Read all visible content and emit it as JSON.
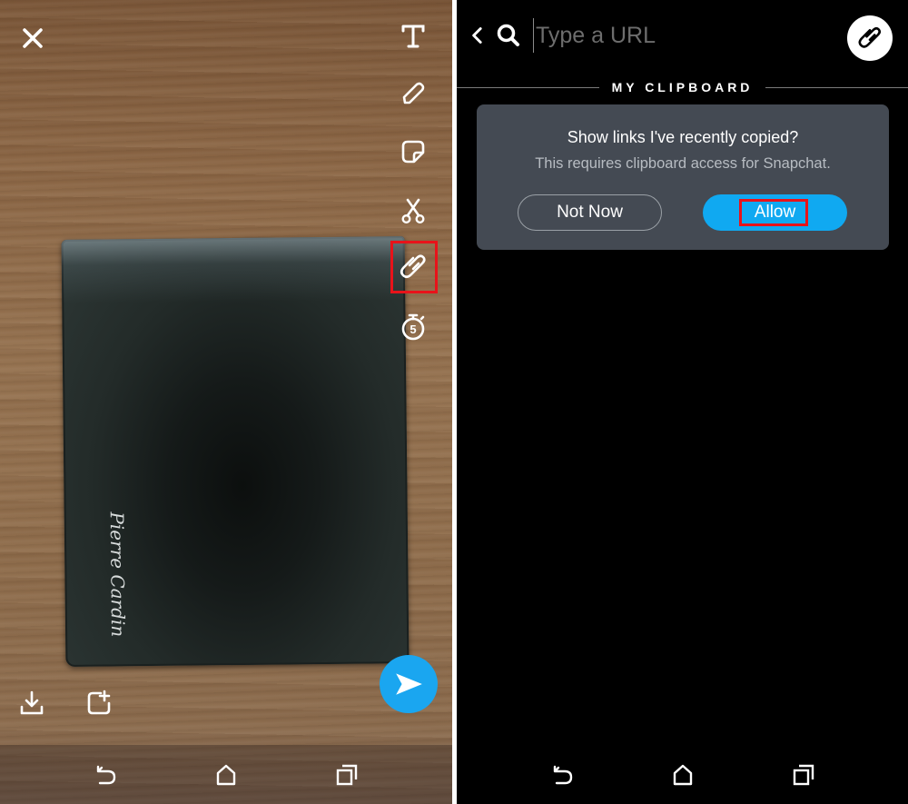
{
  "left_panel": {
    "description": "Snapchat snap editor with photo of a black wallet on a wooden table",
    "photo_brand_text": "Pierre Cardin",
    "tools": [
      {
        "name": "text-tool",
        "icon": "text-T-icon"
      },
      {
        "name": "pencil-tool",
        "icon": "pencil-icon"
      },
      {
        "name": "sticker-tool",
        "icon": "sticker-icon"
      },
      {
        "name": "scissors-tool",
        "icon": "scissors-icon"
      },
      {
        "name": "paperclip-tool",
        "icon": "paperclip-icon",
        "highlighted": true
      },
      {
        "name": "timer-tool",
        "icon": "timer-icon",
        "value": "5"
      }
    ],
    "timer_value": "5",
    "close_icon": "close-x-icon",
    "bottom": {
      "save_icon": "download-icon",
      "story_icon": "add-to-story-icon",
      "send_icon": "send-arrow-icon"
    },
    "navbar": [
      "back-icon",
      "home-icon",
      "recents-icon"
    ]
  },
  "right_panel": {
    "search": {
      "placeholder": "Type a URL",
      "value": ""
    },
    "section_title": "MY CLIPBOARD",
    "dialog": {
      "title": "Show links I've recently copied?",
      "subtitle": "This requires clipboard access for Snapchat.",
      "not_now_label": "Not Now",
      "allow_label": "Allow"
    },
    "navbar": [
      "back-icon",
      "home-icon",
      "recents-icon"
    ]
  },
  "colors": {
    "accent_blue": "#10a9f1",
    "highlight_red": "#e8131a",
    "card_bg": "#444a53"
  }
}
